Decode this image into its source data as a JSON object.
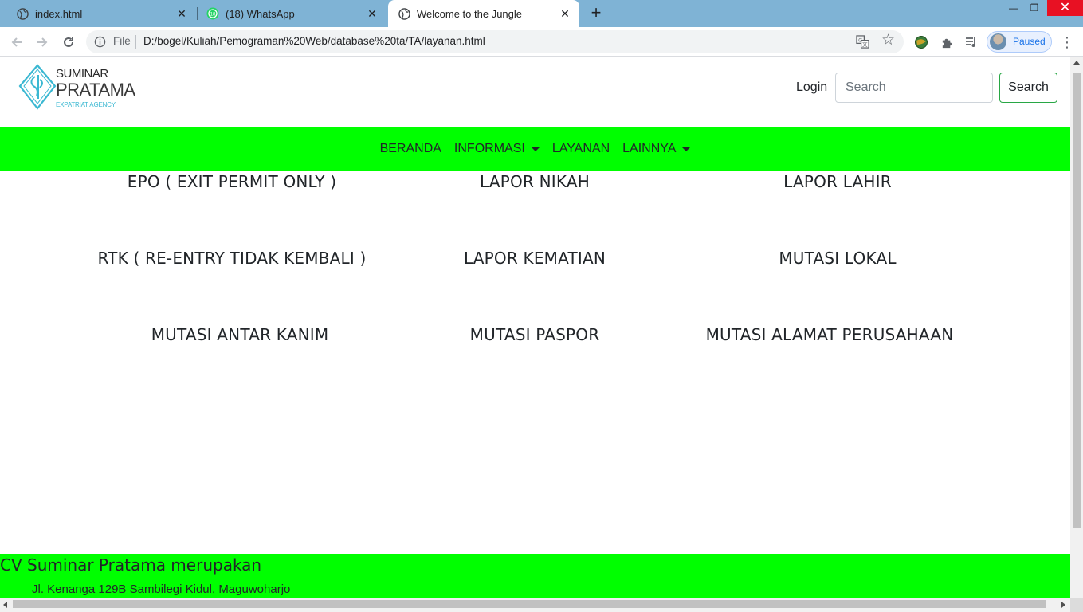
{
  "browser": {
    "tabs": [
      {
        "title": "index.html",
        "active": false
      },
      {
        "title": "(18) WhatsApp",
        "active": false
      },
      {
        "title": "Welcome to the Jungle",
        "active": true
      }
    ],
    "address": {
      "scheme_label": "File",
      "url": "D:/bogel/Kuliah/Pemograman%20Web/database%20ta/TA/layanan.html"
    },
    "profile_label": "Paused"
  },
  "site": {
    "logo": {
      "line1": "SUMINAR",
      "line2": "PRATAMA",
      "line3": "EXPATRIAT AGENCY"
    },
    "login_label": "Login",
    "search": {
      "placeholder": "Search",
      "button_label": "Search"
    },
    "nav": [
      {
        "label": "BERANDA"
      },
      {
        "label": "INFORMASI"
      },
      {
        "label": "LAYANAN"
      },
      {
        "label": "LAINNYA"
      }
    ],
    "services": [
      "EPO ( EXIT PERMIT ONLY )",
      "LAPOR NIKAH",
      "LAPOR LAHIR",
      "RTK ( RE-ENTRY TIDAK KEMBALI )",
      "LAPOR KEMATIAN",
      "MUTASI LOKAL",
      "MUTASI ANTAR KANIM",
      "MUTASI PASPOR",
      "MUTASI ALAMAT PERUSAHAAN"
    ],
    "footer": {
      "title": "CV Suminar Pratama merupakan",
      "address": "Jl. Kenanga 129B Sambilegi Kidul, Maguwoharjo"
    }
  },
  "colors": {
    "accent_green": "#00ff00",
    "tabstrip": "#7fb3d5",
    "logo_teal": "#3bb8d2"
  }
}
